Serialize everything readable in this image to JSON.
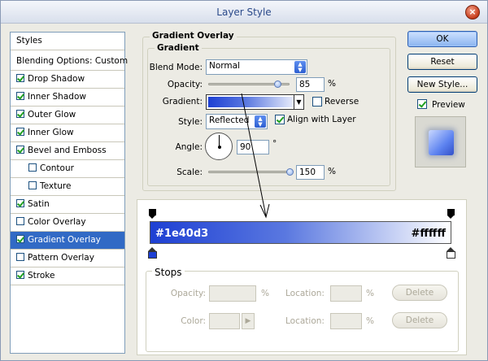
{
  "window": {
    "title": "Layer Style",
    "close_glyph": "×"
  },
  "styles_panel": {
    "header": "Styles",
    "items": [
      {
        "label": "Blending Options: Custom",
        "checkbox": false,
        "checked": false
      },
      {
        "label": "Drop Shadow",
        "checkbox": true,
        "checked": true
      },
      {
        "label": "Inner Shadow",
        "checkbox": true,
        "checked": true
      },
      {
        "label": "Outer Glow",
        "checkbox": true,
        "checked": true
      },
      {
        "label": "Inner Glow",
        "checkbox": true,
        "checked": true
      },
      {
        "label": "Bevel and Emboss",
        "checkbox": true,
        "checked": true
      },
      {
        "label": "Contour",
        "checkbox": true,
        "checked": false
      },
      {
        "label": "Texture",
        "checkbox": true,
        "checked": false
      },
      {
        "label": "Satin",
        "checkbox": true,
        "checked": true
      },
      {
        "label": "Color Overlay",
        "checkbox": true,
        "checked": false
      },
      {
        "label": "Gradient Overlay",
        "checkbox": true,
        "checked": true,
        "selected": true
      },
      {
        "label": "Pattern Overlay",
        "checkbox": true,
        "checked": false
      },
      {
        "label": "Stroke",
        "checkbox": true,
        "checked": true
      }
    ]
  },
  "gradient_overlay": {
    "section_title": "Gradient Overlay",
    "group_title": "Gradient",
    "blend_mode_label": "Blend Mode:",
    "blend_mode_value": "Normal",
    "opacity_label": "Opacity:",
    "opacity_value": "85",
    "opacity_level": 0.85,
    "gradient_label": "Gradient:",
    "reverse_label": "Reverse",
    "reverse_checked": false,
    "style_label": "Style:",
    "style_value": "Reflected",
    "align_label": "Align with Layer",
    "align_checked": true,
    "angle_label": "Angle:",
    "angle_value": "90",
    "degree_symbol": "°",
    "scale_label": "Scale:",
    "scale_value": "150",
    "scale_level": 1.0,
    "percent_symbol": "%"
  },
  "buttons": {
    "ok": "OK",
    "reset": "Reset",
    "new_style": "New Style...",
    "preview_label": "Preview",
    "preview_checked": true
  },
  "gradient_editor": {
    "left_color_label": "#1e40d3",
    "right_color_label": "#ffffff",
    "colors": {
      "start": "#1e40d3",
      "end": "#ffffff"
    },
    "stops_title": "Stops",
    "opacity_label": "Opacity:",
    "color_label": "Color:",
    "location_label": "Location:",
    "percent_symbol": "%",
    "delete_label": "Delete"
  }
}
